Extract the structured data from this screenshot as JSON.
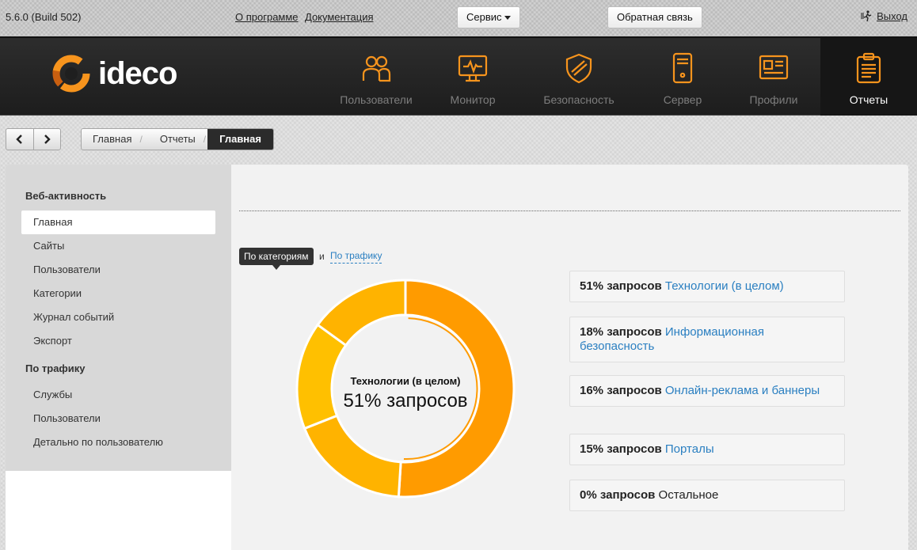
{
  "topbar": {
    "version": "5.6.0 (Build 502)",
    "about_link": "О программе",
    "docs_link": "Документация",
    "service_button": "Сервис",
    "feedback_button": "Обратная связь",
    "logout": "Выход"
  },
  "brand": {
    "logo_text": "ideco"
  },
  "nav": [
    {
      "label": "Пользователи",
      "icon": "users-icon"
    },
    {
      "label": "Монитор",
      "icon": "monitor-icon"
    },
    {
      "label": "Безопасность",
      "icon": "shield-icon"
    },
    {
      "label": "Сервер",
      "icon": "server-icon"
    },
    {
      "label": "Профили",
      "icon": "profiles-icon"
    },
    {
      "label": "Отчеты",
      "icon": "reports-icon",
      "active": true
    }
  ],
  "breadcrumb": [
    "Главная",
    "Отчеты",
    "Главная"
  ],
  "sidebar": {
    "section1": "Веб-активность",
    "items1": [
      "Главная",
      "Сайты",
      "Пользователи",
      "Категории",
      "Журнал событий",
      "Экспорт"
    ],
    "section2": "По трафику",
    "items2": [
      "Службы",
      "Пользователи",
      "Детально по пользователю"
    ]
  },
  "tabs": {
    "by_category": "По категориям",
    "and": "и",
    "by_traffic": "По трафику"
  },
  "donut_center": {
    "title": "Технологии (в целом)",
    "value": "51% запросов"
  },
  "legend": [
    {
      "pct": "51% запросов",
      "category": "Технологии (в целом)",
      "link": true
    },
    {
      "pct": "18% запросов",
      "category": "Информационная безопасность",
      "link": true
    },
    {
      "pct": "16% запросов",
      "category": "Онлайн-реклама и баннеры",
      "link": true
    },
    {
      "pct": "15% запросов",
      "category": "Порталы",
      "link": true
    },
    {
      "pct": "0% запросов",
      "category": "Остальное",
      "link": false
    }
  ],
  "chart_data": {
    "type": "pie",
    "donut": true,
    "categories": [
      "Технологии (в целом)",
      "Информационная безопасность",
      "Онлайн-реклама и баннеры",
      "Порталы",
      "Остальное"
    ],
    "values": [
      51,
      18,
      16,
      15,
      0
    ],
    "colors": [
      "#ff9b00",
      "#ffb300",
      "#ffc000",
      "#ffb300",
      "#ffd040"
    ]
  },
  "colors": {
    "accent": "#f7941d",
    "link": "#2a7fc1",
    "nav_bg": "#252525"
  }
}
